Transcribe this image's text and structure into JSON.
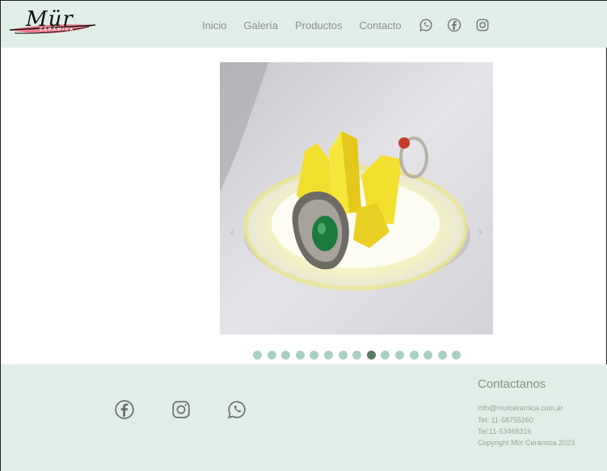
{
  "header": {
    "logo": {
      "word": "Mür",
      "sub": "CERÁMICA"
    },
    "nav": [
      {
        "label": "Inicio"
      },
      {
        "label": "Galería"
      },
      {
        "label": "Productos"
      },
      {
        "label": "Contacto"
      }
    ],
    "icons": [
      "whatsapp-icon",
      "facebook-icon",
      "instagram-icon"
    ]
  },
  "carousel": {
    "prev_glyph": "‹",
    "next_glyph": "›",
    "slide_count": 15,
    "active_index": 8
  },
  "footer": {
    "icons": [
      "facebook-icon",
      "instagram-icon",
      "whatsapp-icon"
    ],
    "title": "Contactanos",
    "email": "info@murceramica.com.ar",
    "phone1": "Tel: 11-58755260",
    "phone2": "Tel:11-53468316",
    "copyright": "Copyright Mür Cerámica 2023."
  },
  "colors": {
    "band": "#dfeee7",
    "dot": "#a9cfc3",
    "dot_active": "#5a7a62",
    "logo_pink": "#f07c8a"
  }
}
